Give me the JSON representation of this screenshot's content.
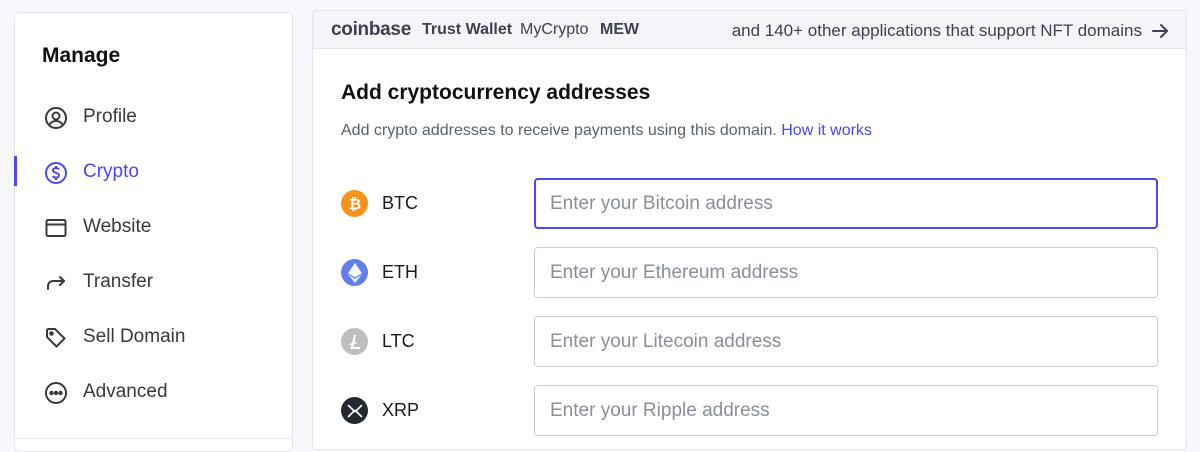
{
  "sidebar": {
    "title": "Manage",
    "items": [
      {
        "label": "Profile",
        "icon": "user-circle-icon"
      },
      {
        "label": "Crypto",
        "icon": "dollar-circle-icon",
        "active": true
      },
      {
        "label": "Website",
        "icon": "browser-window-icon"
      },
      {
        "label": "Transfer",
        "icon": "share-arrow-icon"
      },
      {
        "label": "Sell Domain",
        "icon": "tag-icon"
      },
      {
        "label": "Advanced",
        "icon": "more-dots-icon"
      }
    ]
  },
  "banner": {
    "apps": [
      "coinbase",
      "Trust Wallet",
      "MyCrypto",
      "MEW"
    ],
    "link_text": "and 140+ other applications that support NFT domains",
    "arrow_icon": "arrow-right-icon"
  },
  "crypto": {
    "title": "Add cryptocurrency addresses",
    "description": "Add crypto addresses to receive payments using this domain.",
    "how_it_works": "How it works",
    "coins": [
      {
        "symbol": "BTC",
        "placeholder": "Enter your Bitcoin address",
        "color": "#f7931a",
        "icon": "bitcoin-icon"
      },
      {
        "symbol": "ETH",
        "placeholder": "Enter your Ethereum address",
        "color": "#627eea",
        "icon": "ethereum-icon"
      },
      {
        "symbol": "LTC",
        "placeholder": "Enter your Litecoin address",
        "color": "#bebebe",
        "icon": "litecoin-icon"
      },
      {
        "symbol": "XRP",
        "placeholder": "Enter your Ripple address",
        "color": "#23292f",
        "icon": "ripple-icon"
      }
    ]
  },
  "colors": {
    "accent": "#4c47f7",
    "background": "#f6f8fc",
    "border": "#c8ccd4"
  }
}
